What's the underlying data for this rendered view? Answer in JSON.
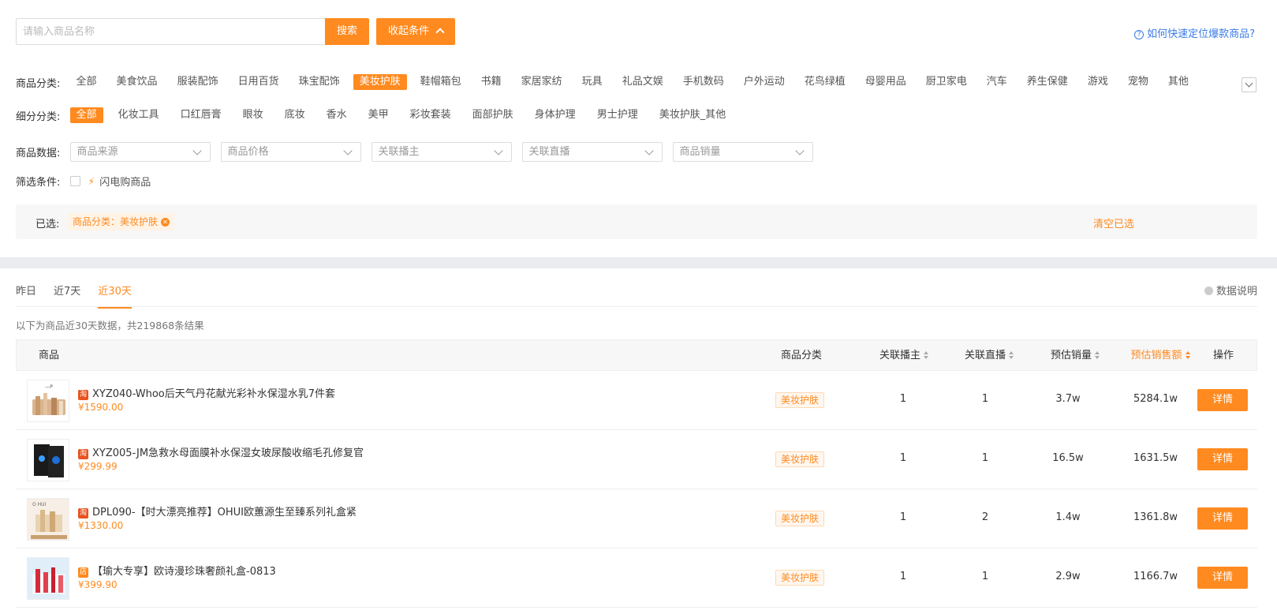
{
  "search": {
    "placeholder": "请输入商品名称",
    "search_label": "搜索",
    "collapse_label": "收起条件",
    "help_link": "如何快速定位爆款商品?"
  },
  "filters": {
    "category_label": "商品分类:",
    "categories": [
      "全部",
      "美食饮品",
      "服装配饰",
      "日用百货",
      "珠宝配饰",
      "美妆护肤",
      "鞋帽箱包",
      "书籍",
      "家居家纺",
      "玩具",
      "礼品文娱",
      "手机数码",
      "户外运动",
      "花鸟绿植",
      "母婴用品",
      "厨卫家电",
      "汽车",
      "养生保健",
      "游戏",
      "宠物",
      "其他"
    ],
    "active_category": "美妆护肤",
    "subcategory_label": "细分分类:",
    "subcategories": [
      "全部",
      "化妆工具",
      "口红唇膏",
      "眼妆",
      "底妆",
      "香水",
      "美甲",
      "彩妆套装",
      "面部护肤",
      "身体护理",
      "男士护理",
      "美妆护肤_其他"
    ],
    "active_subcategory": "全部",
    "data_label": "商品数据:",
    "selects": [
      "商品来源",
      "商品价格",
      "关联播主",
      "关联直播",
      "商品销量"
    ],
    "condition_label": "筛选条件:",
    "flash_label": "闪电购商品"
  },
  "selected": {
    "label": "已选:",
    "tag": "商品分类：美妆护肤",
    "clear_label": "清空已选"
  },
  "tabs": [
    "昨日",
    "近7天",
    "近30天"
  ],
  "active_tab": "近30天",
  "data_note": "数据说明",
  "result_text": "以下为商品近30天数据，共219868条结果",
  "table": {
    "headers": {
      "product": "商品",
      "category": "商品分类",
      "hosts": "关联播主",
      "lives": "关联直播",
      "est_sales": "预估销量",
      "est_revenue": "预估销售额",
      "action": "操作"
    },
    "sorted_column": "预估销售额",
    "detail_label": "详情",
    "rows": [
      {
        "name": "XYZ040-Whoo后天气丹花献光彩补水保湿水乳7件套",
        "price": "¥1590.00",
        "category": "美妆护肤",
        "hosts": "1",
        "lives": "1",
        "sales": "3.7w",
        "revenue": "5284.1w",
        "platform": "淘"
      },
      {
        "name": "XYZ005-JM急救水母面膜补水保湿女玻尿酸收缩毛孔修复官",
        "price": "¥299.99",
        "category": "美妆护肤",
        "hosts": "1",
        "lives": "1",
        "sales": "16.5w",
        "revenue": "1631.5w",
        "platform": "淘"
      },
      {
        "name": "DPL090-【时大漂亮推荐】OHUI欧蕙源生至臻系列礼盒紧",
        "price": "¥1330.00",
        "category": "美妆护肤",
        "hosts": "1",
        "lives": "2",
        "sales": "1.4w",
        "revenue": "1361.8w",
        "platform": "淘"
      },
      {
        "name": "【瑜大专享】欧诗漫珍珠奢颜礼盒-0813",
        "price": "¥399.90",
        "category": "美妆护肤",
        "hosts": "1",
        "lives": "1",
        "sales": "2.9w",
        "revenue": "1166.7w",
        "platform": "店"
      }
    ]
  },
  "colors": {
    "accent": "#ff8a1f",
    "link": "#3a7be8"
  }
}
